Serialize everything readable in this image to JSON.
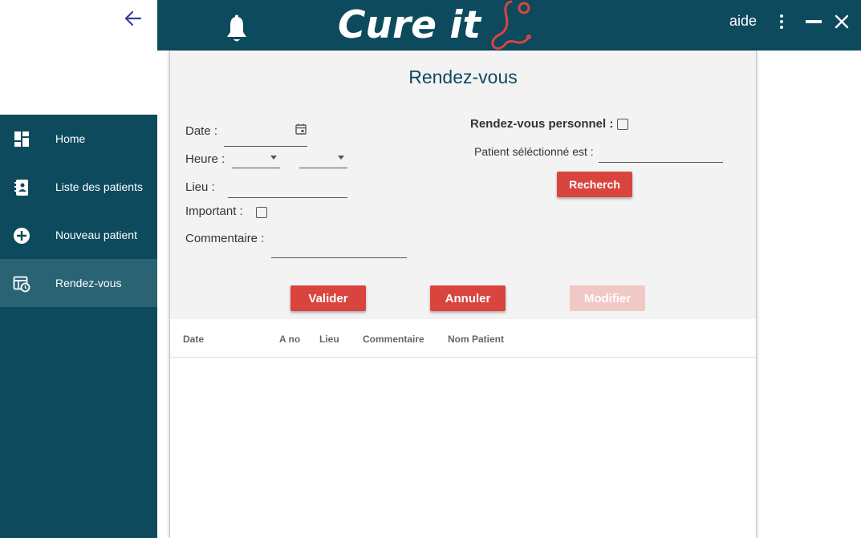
{
  "app": {
    "logo_text": "Cure it",
    "help_label": "aide"
  },
  "sidebar": {
    "items": [
      {
        "label": "Home",
        "icon": "dashboard-icon",
        "active": false
      },
      {
        "label": "Liste des patients",
        "icon": "patients-list-icon",
        "active": false
      },
      {
        "label": "Nouveau patient",
        "icon": "add-circle-icon",
        "active": false
      },
      {
        "label": "Rendez-vous",
        "icon": "calendar-clock-icon",
        "active": true
      }
    ]
  },
  "form": {
    "title": "Rendez-vous",
    "date_label": "Date :",
    "date_value": "",
    "heure_label": "Heure :",
    "hour_value": "",
    "minute_value": "",
    "lieu_label": "Lieu :",
    "lieu_value": "",
    "important_label": "Important :",
    "important_checked": false,
    "commentaire_label": "Commentaire :",
    "commentaire_value": "",
    "personnel_label": "Rendez-vous personnel :",
    "personnel_checked": false,
    "patient_label": "Patient séléctionné est :",
    "patient_value": "",
    "search_button": "Recherch",
    "validate_button": "Valider",
    "cancel_button": "Annuler",
    "modify_button": "Modifier"
  },
  "table": {
    "columns": [
      "Date",
      "A no",
      "Lieu",
      "Commentaire",
      "Nom Patient"
    ],
    "rows": []
  },
  "colors": {
    "primary": "#0d4a5e",
    "sidebar_active": "#2a6474",
    "accent_button": "#d9453e",
    "button_disabled": "#f0c8c6",
    "stethoscope": "#d9453e"
  }
}
